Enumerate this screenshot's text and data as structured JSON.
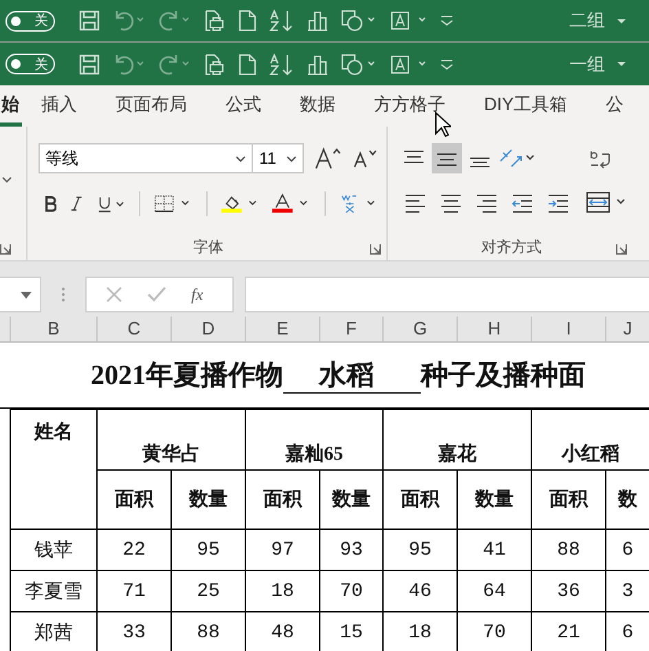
{
  "quick_access_bars": [
    {
      "toggle": {
        "label": "关",
        "on": false
      },
      "group": "二组"
    },
    {
      "toggle": {
        "label": "关",
        "on": false
      },
      "group": "一组"
    }
  ],
  "tabs": [
    {
      "label": "始",
      "selected": true
    },
    {
      "label": "插入",
      "selected": false
    },
    {
      "label": "页面布局",
      "selected": false
    },
    {
      "label": "公式",
      "selected": false
    },
    {
      "label": "数据",
      "selected": false
    },
    {
      "label": "方方格子",
      "selected": false
    },
    {
      "label": "DIY工具箱",
      "selected": false
    },
    {
      "label": "公",
      "selected": false
    }
  ],
  "ribbon": {
    "font_group": {
      "label": "字体",
      "font_name": "等线",
      "font_size": "11"
    },
    "align_group": {
      "label": "对齐方式",
      "vertical_align": [
        {
          "selected": false
        },
        {
          "selected": true
        },
        {
          "selected": false
        }
      ]
    }
  },
  "formula_bar": {
    "fx": "fx"
  },
  "columns": [
    "B",
    "C",
    "D",
    "E",
    "F",
    "G",
    "H",
    "I",
    "J"
  ],
  "sheet": {
    "title": {
      "prefix": "2021年夏播作物",
      "crop": "水稻",
      "suffix": "种子及播种面"
    },
    "name_header": "姓名",
    "varieties": [
      "黄华占",
      "嘉籼65",
      "嘉花",
      "小红稻"
    ],
    "sub_headers": [
      "面积",
      "数量",
      "面积",
      "数量",
      "面积",
      "数量",
      "面积",
      "数"
    ],
    "rows": [
      {
        "name": "钱苹",
        "values": [
          "22",
          "95",
          "97",
          "93",
          "95",
          "41",
          "88",
          "6"
        ]
      },
      {
        "name": "李夏雪",
        "values": [
          "71",
          "25",
          "18",
          "70",
          "46",
          "64",
          "36",
          "3"
        ]
      },
      {
        "name": "郑茜",
        "values": [
          "33",
          "88",
          "48",
          "15",
          "18",
          "70",
          "21",
          "6"
        ]
      }
    ]
  }
}
